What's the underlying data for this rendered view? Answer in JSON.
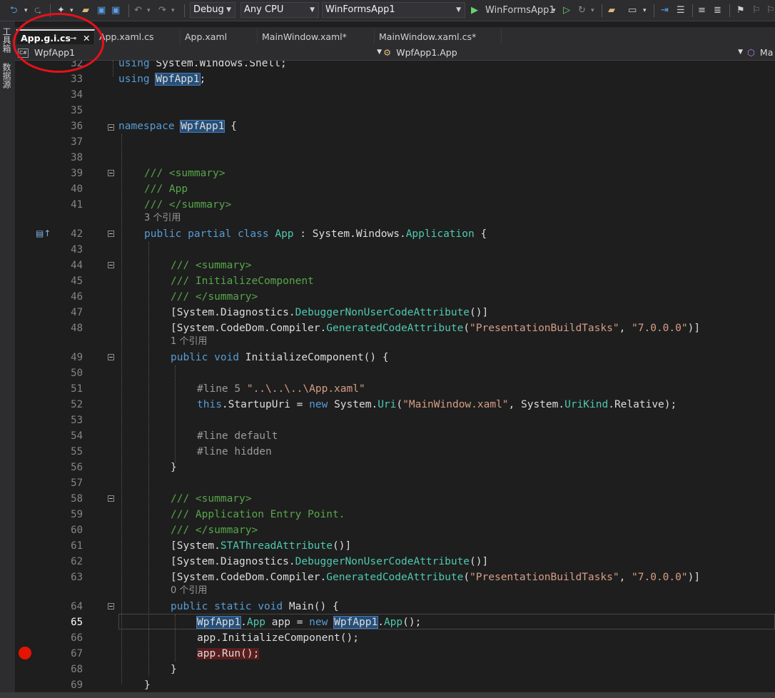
{
  "toolbar": {
    "config": "Debug",
    "platform": "Any CPU",
    "project": "WinFormsApp1",
    "start_target": "WinFormsApp1"
  },
  "side_panels": [
    "工具箱",
    "数据源"
  ],
  "tabs": [
    {
      "label": "App.g.i.cs",
      "active": true
    },
    {
      "label": "App.xaml.cs"
    },
    {
      "label": "App.xaml"
    },
    {
      "label": "MainWindow.xaml*"
    },
    {
      "label": "MainWindow.xaml.cs*"
    }
  ],
  "nav": {
    "project": "WpfApp1",
    "type": "WpfApp1.App",
    "member": "Ma"
  },
  "editor": {
    "current_line": "65",
    "breakpoint_line": "67",
    "references": {
      "class": "3 个引用",
      "initialize": "1 个引用",
      "main": "0 个引用"
    },
    "line_numbers": [
      "32",
      "33",
      "34",
      "35",
      "36",
      "37",
      "38",
      "39",
      "40",
      "41",
      "42",
      "43",
      "44",
      "45",
      "46",
      "47",
      "48",
      "49",
      "50",
      "51",
      "52",
      "53",
      "54",
      "55",
      "56",
      "57",
      "58",
      "59",
      "60",
      "61",
      "62",
      "63",
      "64",
      "65",
      "66",
      "67",
      "68",
      "69"
    ],
    "lines": {
      "l32": "using System.Windows.Shell;",
      "l33": "using WpfApp1;",
      "l36": "namespace WpfApp1 {",
      "l39": "/// <summary>",
      "l40": "/// App",
      "l41": "/// </summary>",
      "l42": "public partial class App : System.Windows.Application {",
      "l44": "/// <summary>",
      "l45": "/// InitializeComponent",
      "l46": "/// </summary>",
      "l47": "[System.Diagnostics.DebuggerNonUserCodeAttribute()]",
      "l48": "[System.CodeDom.Compiler.GeneratedCodeAttribute(\"PresentationBuildTasks\", \"7.0.0.0\")]",
      "l49": "public void InitializeComponent() {",
      "l51": "#line 5 \"..\\..\\..\\App.xaml\"",
      "l52": "this.StartupUri = new System.Uri(\"MainWindow.xaml\", System.UriKind.Relative);",
      "l54": "#line default",
      "l55": "#line hidden",
      "l56": "}",
      "l58": "/// <summary>",
      "l59": "/// Application Entry Point.",
      "l60": "/// </summary>",
      "l61": "[System.STAThreadAttribute()]",
      "l62": "[System.Diagnostics.DebuggerNonUserCodeAttribute()]",
      "l63": "[System.CodeDom.Compiler.GeneratedCodeAttribute(\"PresentationBuildTasks\", \"7.0.0.0\")]",
      "l64": "public static void Main() {",
      "l65": "WpfApp1.App app = new WpfApp1.App();",
      "l66": "app.InitializeComponent();",
      "l67": "app.Run();",
      "l68": "}",
      "l69": "}"
    }
  },
  "colors": {
    "keyword": "#569cd6",
    "type": "#4ec9b0",
    "comment": "#57a64a",
    "string": "#d69d85",
    "breakpoint": "#e51400",
    "annotation": "#e8101a"
  }
}
